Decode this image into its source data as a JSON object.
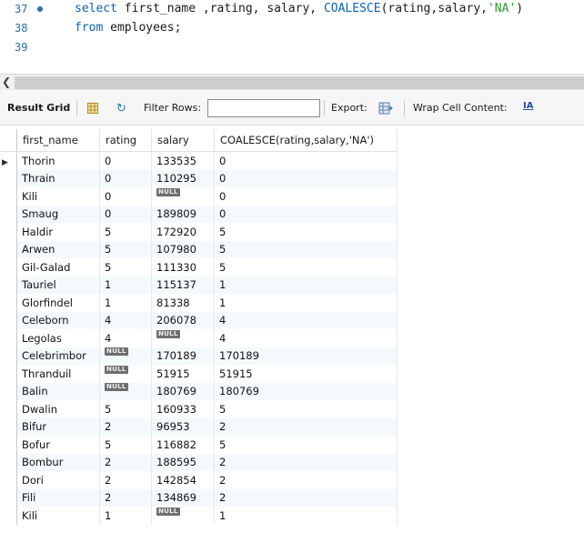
{
  "editor": {
    "lines": [
      {
        "num": "37",
        "has_dot": true,
        "tokens": [
          {
            "t": "select",
            "c": "kw"
          },
          {
            "t": " first_name ,rating, salary, ",
            "c": ""
          },
          {
            "t": "COALESCE",
            "c": "fn"
          },
          {
            "t": "(rating,salary,",
            "c": ""
          },
          {
            "t": "'NA'",
            "c": "str"
          },
          {
            "t": ")",
            "c": ""
          }
        ]
      },
      {
        "num": "38",
        "has_dot": false,
        "tokens": [
          {
            "t": "from",
            "c": "kw"
          },
          {
            "t": " employees;",
            "c": ""
          }
        ]
      },
      {
        "num": "39",
        "has_dot": false,
        "tokens": []
      }
    ]
  },
  "toolbar": {
    "result_grid_label": "Result Grid",
    "filter_label": "Filter Rows:",
    "filter_value": "",
    "export_label": "Export:",
    "wrap_label": "Wrap Cell Content:",
    "wrap_icon_text": "IA"
  },
  "grid": {
    "columns": [
      "first_name",
      "rating",
      "salary",
      "COALESCE(rating,salary,'NA')"
    ],
    "null_text": "NULL",
    "rows": [
      [
        "Thorin",
        "0",
        "133535",
        "0"
      ],
      [
        "Thrain",
        "0",
        "110295",
        "0"
      ],
      [
        "Kili",
        "0",
        null,
        "0"
      ],
      [
        "Smaug",
        "0",
        "189809",
        "0"
      ],
      [
        "Haldir",
        "5",
        "172920",
        "5"
      ],
      [
        "Arwen",
        "5",
        "107980",
        "5"
      ],
      [
        "Gil-Galad",
        "5",
        "111330",
        "5"
      ],
      [
        "Tauriel",
        "1",
        "115137",
        "1"
      ],
      [
        "Glorfindel",
        "1",
        "81338",
        "1"
      ],
      [
        "Celeborn",
        "4",
        "206078",
        "4"
      ],
      [
        "Legolas",
        "4",
        null,
        "4"
      ],
      [
        "Celebrimbor",
        null,
        "170189",
        "170189"
      ],
      [
        "Thranduil",
        null,
        "51915",
        "51915"
      ],
      [
        "Balin",
        null,
        "180769",
        "180769"
      ],
      [
        "Dwalin",
        "5",
        "160933",
        "5"
      ],
      [
        "Bifur",
        "2",
        "96953",
        "2"
      ],
      [
        "Bofur",
        "5",
        "116882",
        "5"
      ],
      [
        "Bombur",
        "2",
        "188595",
        "2"
      ],
      [
        "Dori",
        "2",
        "142854",
        "2"
      ],
      [
        "Fili",
        "2",
        "134869",
        "2"
      ],
      [
        "Kili",
        "1",
        null,
        "1"
      ]
    ]
  }
}
